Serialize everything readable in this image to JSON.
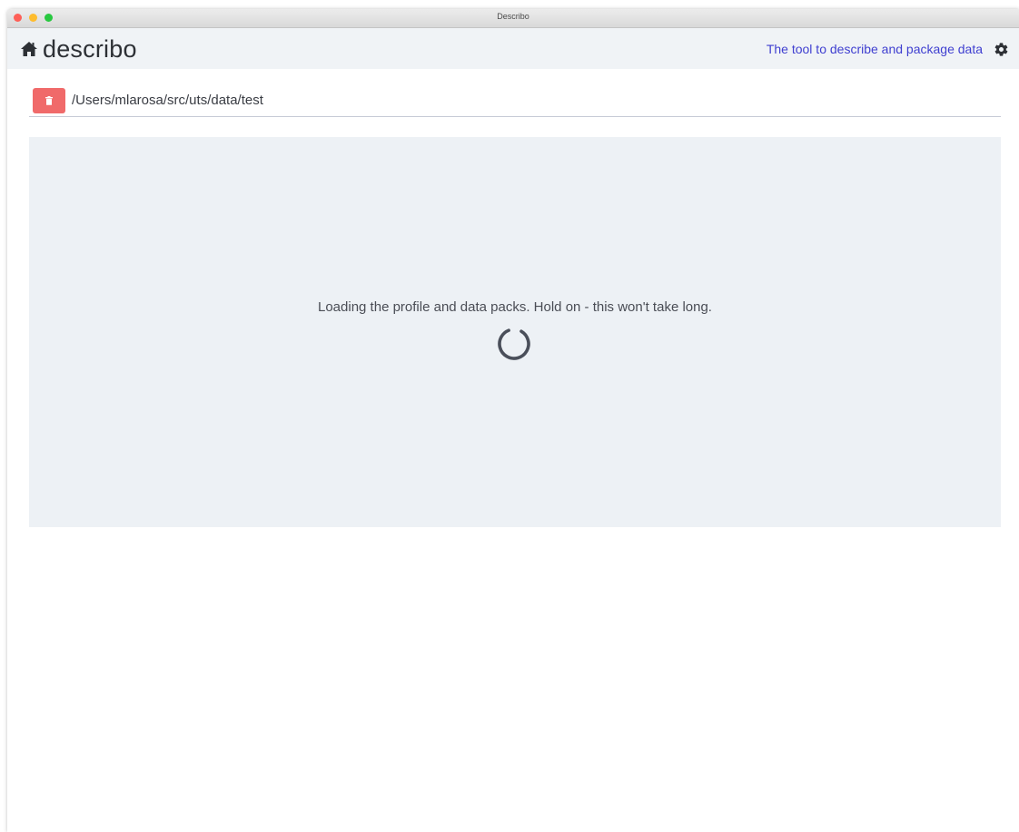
{
  "window": {
    "title": "Describo"
  },
  "header": {
    "brand": "describo",
    "tagline": "The tool to describe and package data",
    "icons": {
      "home": "home-icon",
      "settings": "gear-icon"
    }
  },
  "folder": {
    "path": "/Users/mlarosa/src/uts/data/test",
    "remove_icon": "trash-icon",
    "remove_color": "#f06a6a"
  },
  "main": {
    "loading_message": "Loading the profile and data packs. Hold on - this won't take long.",
    "spinner_icon": "spinner-icon"
  },
  "colors": {
    "accent_link": "#3f3fd0",
    "panel_background": "#edf1f5",
    "header_background": "#f0f3f6"
  }
}
